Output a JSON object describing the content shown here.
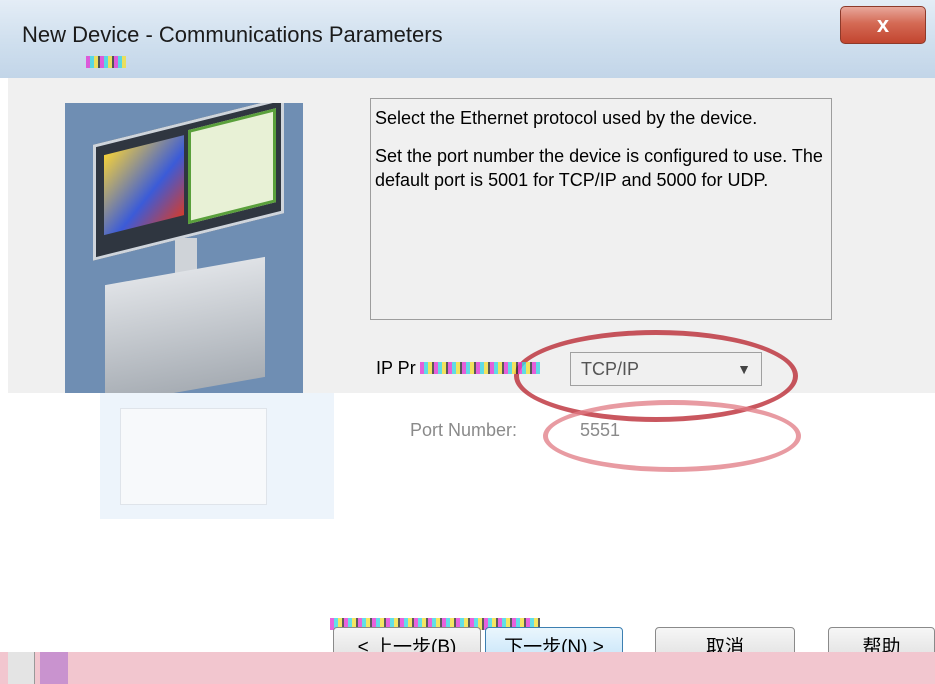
{
  "window": {
    "title": "New Device - Communications Parameters",
    "close_label": "x"
  },
  "description": {
    "line1": "Select the Ethernet protocol used by the device.",
    "line2": "Set the port number the device is configured to use. The default port is 5001 for TCP/IP and 5000 for UDP."
  },
  "form": {
    "protocol_label": "IP Pr",
    "protocol_value": "TCP/IP",
    "port_label": "Port Number:",
    "port_value": "5551"
  },
  "buttons": {
    "back": "< 上一步(B)",
    "next": "下一步(N) >",
    "cancel": "取消",
    "help": "帮助"
  },
  "icons": [
    "close-icon",
    "chevron-down-icon"
  ],
  "colors": {
    "annotation_red": "#b20f1b",
    "annotation_pink": "#e07a83",
    "dialog_bg": "#f0f0f0",
    "illustration_bg": "#6f8eb3"
  }
}
